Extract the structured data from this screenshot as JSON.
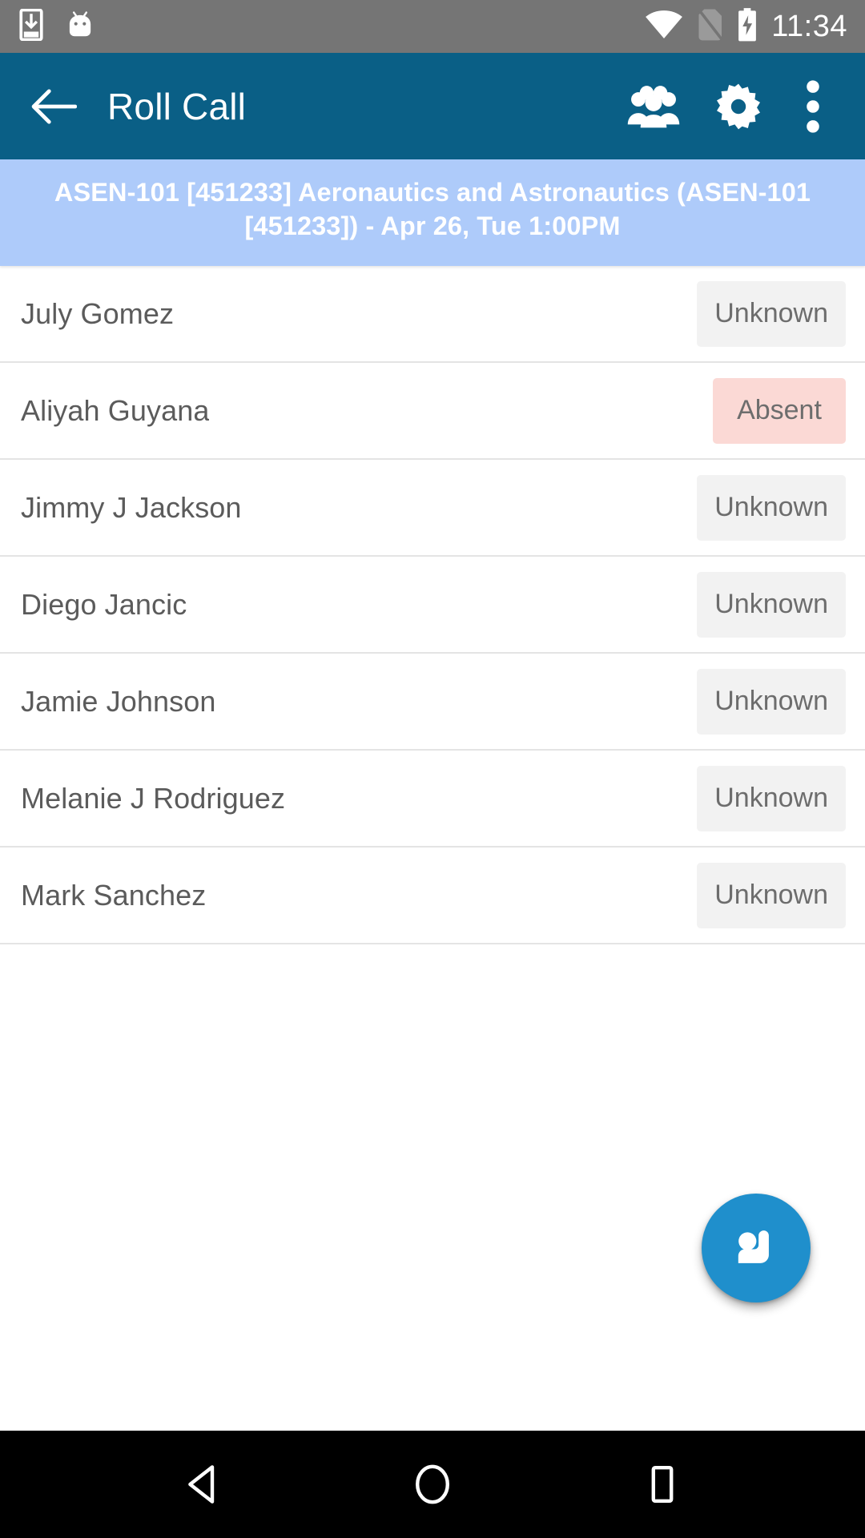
{
  "status_bar": {
    "time": "11:34",
    "icons": [
      "download-to-phone-icon",
      "android-mascot-icon",
      "wifi-icon",
      "no-sim-icon",
      "battery-charging-icon"
    ]
  },
  "app_bar": {
    "title": "Roll Call",
    "back_label": "Back",
    "actions": [
      {
        "name": "group-icon",
        "label": "Groups"
      },
      {
        "name": "gear-icon",
        "label": "Settings"
      },
      {
        "name": "overflow-menu-icon",
        "label": "More options"
      }
    ]
  },
  "banner": {
    "text": "ASEN-101 [451233] Aeronautics and Astronautics (ASEN-101 [451233]) - Apr 26, Tue 1:00PM",
    "course_code": "ASEN-101",
    "section_id": "451233",
    "course_name": "Aeronautics and Astronautics",
    "meeting": "Apr 26, Tue 1:00PM",
    "background": "#aecbfa"
  },
  "roster": {
    "students": [
      {
        "name": "July Gomez",
        "status": "Unknown",
        "state": "unknown"
      },
      {
        "name": "Aliyah Guyana",
        "status": "Absent",
        "state": "absent"
      },
      {
        "name": "Jimmy J Jackson",
        "status": "Unknown",
        "state": "unknown"
      },
      {
        "name": "Diego Jancic",
        "status": "Unknown",
        "state": "unknown"
      },
      {
        "name": "Jamie Johnson",
        "status": "Unknown",
        "state": "unknown"
      },
      {
        "name": "Melanie J Rodriguez",
        "status": "Unknown",
        "state": "unknown"
      },
      {
        "name": "Mark Sanchez",
        "status": "Unknown",
        "state": "unknown"
      }
    ]
  },
  "fab": {
    "name": "raise-hand-icon",
    "label": "Take attendance",
    "color": "#1f8fcc"
  },
  "nav_bar": {
    "buttons": [
      {
        "name": "nav-back-icon",
        "label": "Back"
      },
      {
        "name": "nav-home-icon",
        "label": "Home"
      },
      {
        "name": "nav-recents-icon",
        "label": "Recents"
      }
    ]
  },
  "colors": {
    "app_bar": "#0a5f86",
    "status_bar": "#757575",
    "banner": "#aecbfa",
    "absent_badge": "#fbd9d5",
    "unknown_badge": "#f2f2f2",
    "fab": "#1f8fcc"
  }
}
